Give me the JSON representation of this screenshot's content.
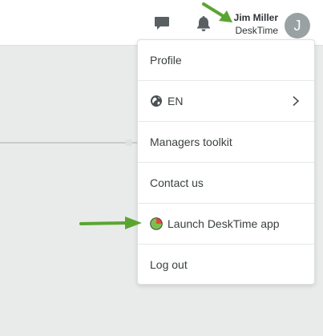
{
  "header": {
    "user_name": "Jim Miller",
    "user_org": "DeskTime",
    "avatar_initial": "J",
    "icons": [
      "chat-icon",
      "bell-icon"
    ]
  },
  "menu": {
    "items": [
      {
        "label": "Profile"
      },
      {
        "label": "EN",
        "icon": "globe-icon",
        "has_submenu": true
      },
      {
        "label": "Managers toolkit"
      },
      {
        "label": "Contact us"
      },
      {
        "label": "Launch DeskTime app",
        "icon": "desktime-app-icon"
      },
      {
        "label": "Log out"
      }
    ]
  },
  "colors": {
    "page_background": "#e9ebea",
    "header_background": "#ffffff",
    "avatar": "#9aa1a3",
    "annotation_arrow": "#5aa532"
  }
}
